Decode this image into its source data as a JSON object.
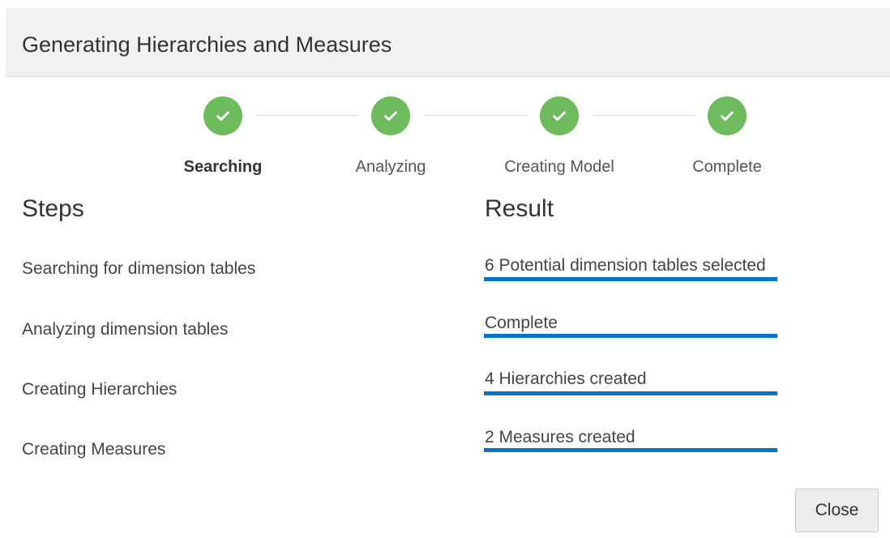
{
  "dialog": {
    "title": "Generating Hierarchies and Measures"
  },
  "stepper": {
    "steps": [
      {
        "label": "Searching",
        "status": "complete",
        "active": true
      },
      {
        "label": "Analyzing",
        "status": "complete",
        "active": false
      },
      {
        "label": "Creating Model",
        "status": "complete",
        "active": false
      },
      {
        "label": "Complete",
        "status": "complete",
        "active": false
      }
    ],
    "check_color": "#6dbb5c"
  },
  "table": {
    "steps_heading": "Steps",
    "result_heading": "Result",
    "rows": [
      {
        "step": "Searching for dimension tables",
        "result": "6 Potential dimension tables selected",
        "progress": 1.0
      },
      {
        "step": "Analyzing dimension tables",
        "result": "Complete",
        "progress": 1.0
      },
      {
        "step": "Creating Hierarchies",
        "result": "4 Hierarchies created",
        "progress": 1.0
      },
      {
        "step": "Creating Measures",
        "result": "2 Measures created",
        "progress": 1.0
      }
    ],
    "progress_color": "#0a73c7"
  },
  "footer": {
    "close_label": "Close"
  }
}
